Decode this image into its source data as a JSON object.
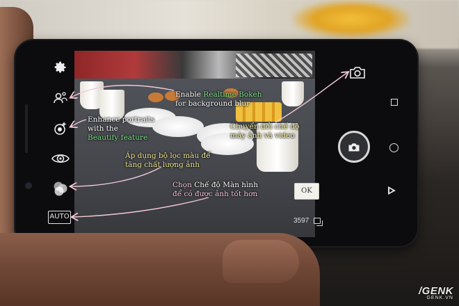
{
  "camera": {
    "auto_label": "AUTO",
    "ok_label": "OK",
    "shots_remaining": "3597"
  },
  "icons": {
    "settings": "gear-icon",
    "bokeh": "realtime-bokeh-icon",
    "beautify": "beautify-icon",
    "filter": "color-filter-icon",
    "mode": "display-mode-icon",
    "switch_camera": "switch-camera-icon",
    "shutter": "camera-shutter-icon",
    "gallery": "gallery-icon"
  },
  "annotations": {
    "bokeh": {
      "prefix": "Enable ",
      "highlight": "Realtime Bokeh",
      "line2": "for background blur"
    },
    "beautify": {
      "line1": "Enhance portraits",
      "line2": "with the",
      "highlight": "Beautify feature"
    },
    "switch": {
      "line1": "Chuyển đổi chế độ",
      "line2": "máy ảnh và video"
    },
    "filter": {
      "line1": "Áp dụng bộ lọc màu để",
      "line2": "tăng chất lượng ảnh"
    },
    "mode": {
      "prefix": "Chọn ",
      "highlight": "Chế độ Màn hình",
      "line2": "để có được ảnh tốt hơn"
    }
  },
  "colors": {
    "arrow": "#f4c9d6",
    "highlight_green": "#7fe28a",
    "note_yellow": "#f6f1a4",
    "note_pink": "#f4c7d7"
  },
  "watermark": {
    "brand": "/GENK",
    "site": "GENK.VN"
  }
}
